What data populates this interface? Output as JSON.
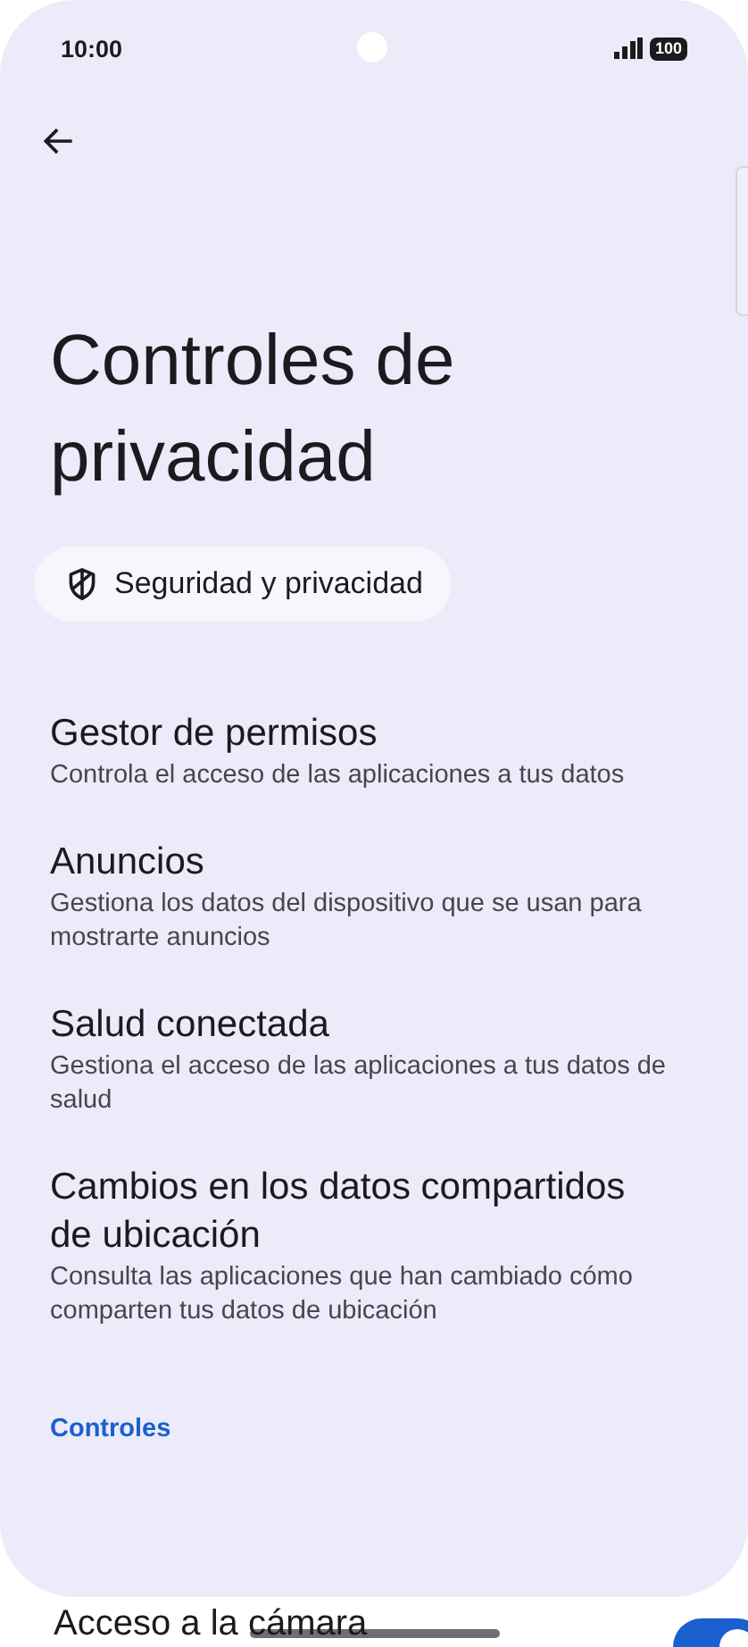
{
  "status_bar": {
    "time": "10:00",
    "battery": "100"
  },
  "title": "Controles de privacidad",
  "breadcrumb": {
    "label": "Seguridad y privacidad"
  },
  "items": [
    {
      "title": "Gestor de permisos",
      "subtitle": "Controla el acceso de las aplicaciones a tus datos"
    },
    {
      "title": "Anuncios",
      "subtitle": "Gestiona los datos del dispositivo que se usan para mostrarte anuncios"
    },
    {
      "title": "Salud conectada",
      "subtitle": "Gestiona el acceso de las aplicaciones a tus datos de salud"
    },
    {
      "title": "Cambios en los datos compartidos de ubicación",
      "subtitle": "Consulta las aplicaciones que han cambiado cómo comparten tus datos de ubicación"
    }
  ],
  "section": {
    "header": "Controles"
  },
  "toggles": [
    {
      "title": "Acceso a la cámara",
      "on": true
    }
  ]
}
